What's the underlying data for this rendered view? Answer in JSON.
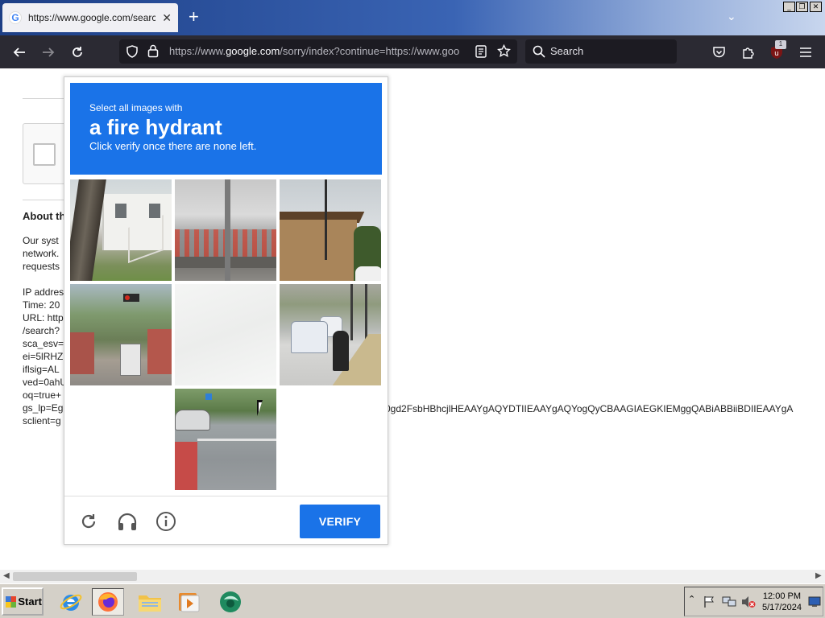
{
  "browser": {
    "tab": {
      "title": "https://www.google.com/search?q=",
      "favicon_letter": "G"
    },
    "url": {
      "prefix": "https://www.",
      "domain": "google.com",
      "rest": "/sorry/index?continue=https://www.goo"
    },
    "search_placeholder": "Search",
    "extension_badge": "1"
  },
  "page": {
    "about_heading": "About th",
    "lines": [
      "Our syst",
      "network.",
      "requests",
      "",
      "IP addres",
      "Time: 20",
      "URL: http",
      "/search?",
      "sca_esv=",
      "ei=5lRHZ",
      "iflsig=AL",
      "ved=0ahU",
      "oq=true+",
      "gs_lp=Eg",
      "sclient=g"
    ],
    "gs_lp_tail": "0gd2FsbHBhcjlHEAAYgAQYDTIIEAAYgAQYogQyCBAAGIAEGKIEMggQABiABBiiBDIIEAAYgA"
  },
  "captcha": {
    "instruction_small": "Select all images with",
    "target": "a fire hydrant",
    "instruction_sub": "Click verify once there are none left.",
    "verify_label": "VERIFY"
  },
  "taskbar": {
    "start_label": "Start",
    "time": "12:00 PM",
    "date": "5/17/2024"
  },
  "colors": {
    "accent": "#1a73e8",
    "browser_toolbar": "#2b2a33",
    "taskbar": "#d4d0c8"
  }
}
